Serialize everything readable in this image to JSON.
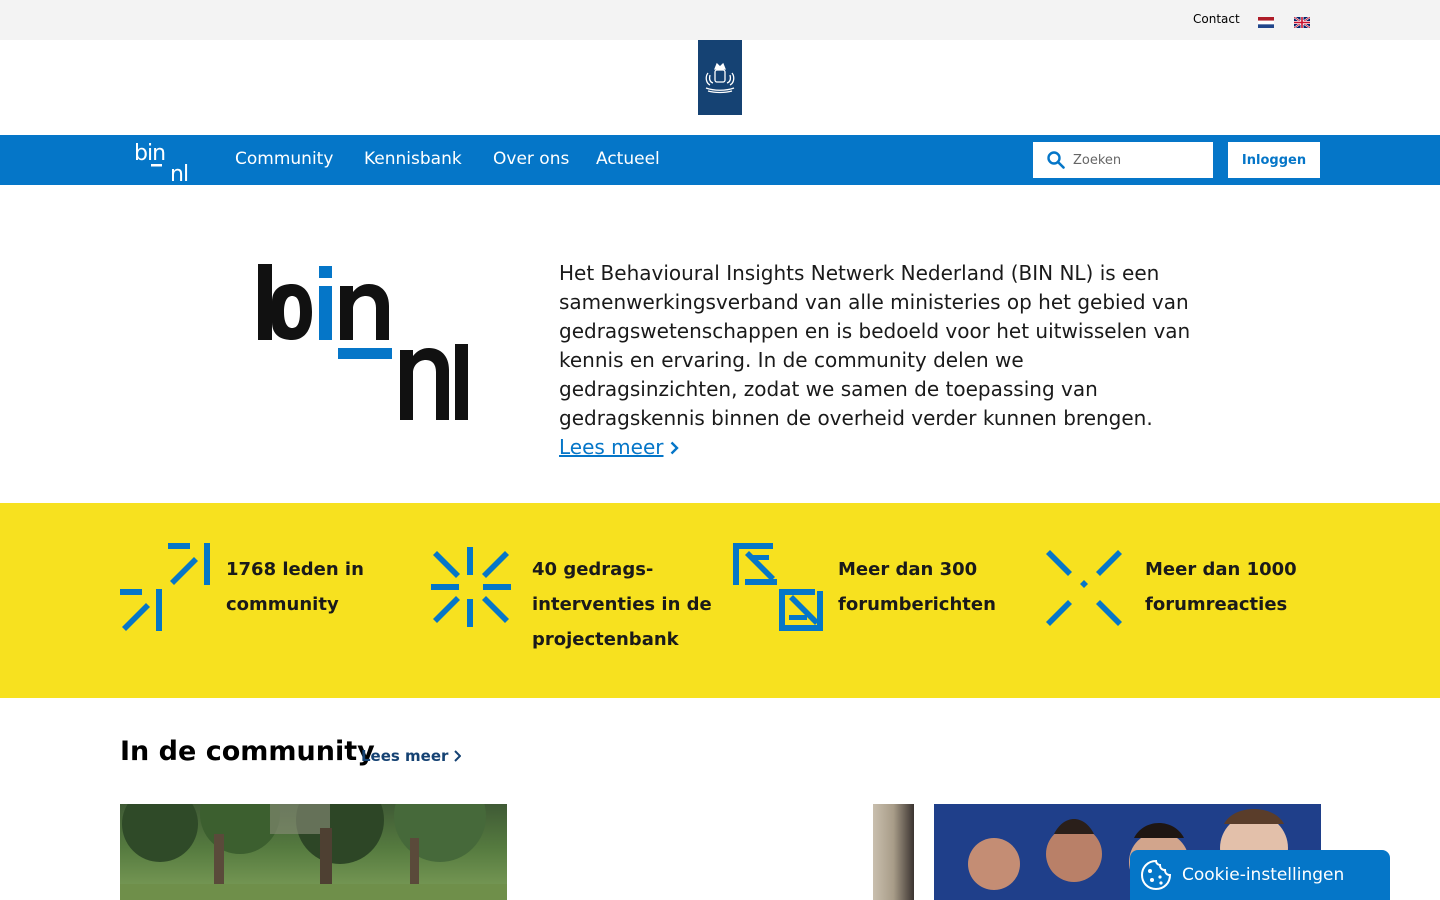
{
  "topbar": {
    "contact": "Contact"
  },
  "nav": {
    "items": [
      {
        "label": "Community"
      },
      {
        "label": "Kennisbank"
      },
      {
        "label": "Over ons"
      },
      {
        "label": "Actueel"
      }
    ],
    "search_placeholder": "Zoeken",
    "login_label": "Inloggen"
  },
  "hero": {
    "text": "Het Behavioural Insights Netwerk Nederland (BIN NL) is een samenwerkingsverband van alle ministeries op het gebied van gedragswetenschappen en is bedoeld voor het uitwisselen van kennis en ervaring. In de community delen we gedragsinzichten, zodat we samen de toepassing van gedragskennis binnen de overheid verder kunnen brengen.",
    "link": "Lees meer"
  },
  "stats": [
    {
      "line1": "1768 leden in",
      "line2": "community",
      "line3": ""
    },
    {
      "line1": "40 gedrags-",
      "line2": "interventies in de",
      "line3": "projectenbank"
    },
    {
      "line1": "Meer dan 300",
      "line2": "forumberichten",
      "line3": ""
    },
    {
      "line1": "Meer dan 1000",
      "line2": "forumreacties",
      "line3": ""
    }
  ],
  "community": {
    "title": "In de community",
    "more": "Lees meer"
  },
  "cookie": {
    "label": "Cookie-instellingen"
  },
  "colors": {
    "nav_blue": "#0576c8",
    "crown_blue": "#154273",
    "stats_yellow": "#f7e11f",
    "icon_blue": "#0576c8"
  }
}
